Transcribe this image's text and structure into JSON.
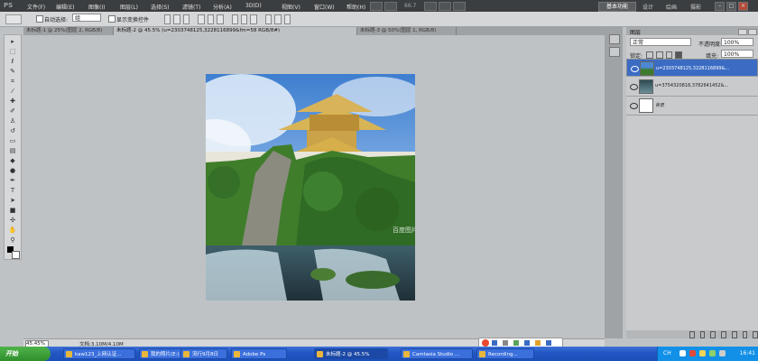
{
  "app": {
    "logo": "PS",
    "menu": [
      "文件(F)",
      "编辑(E)",
      "图像(I)",
      "图层(L)",
      "选择(S)",
      "滤镜(T)",
      "分析(A)",
      "3D(D)",
      "视图(V)",
      "窗口(W)",
      "帮助(H)"
    ],
    "zoom_readout": "66.7",
    "workspaces": {
      "active": "基本功能",
      "others": [
        "设计",
        "绘画",
        "摄影"
      ]
    }
  },
  "options": {
    "auto_select_label": "自动选择:",
    "auto_select_value": "组",
    "transform_label": "显示变换控件"
  },
  "tabs": [
    "未标题-1 @ 25%(图层 2, RGB/8)",
    "未标题-2 @ 45.5% (u=2303748125,3228116899&fm=58 RGB/8#)",
    "未标题-3 @ 50%(图层 1, RGB/8)"
  ],
  "layers_panel": {
    "title": "图层",
    "blend_mode": "正常",
    "opacity_label": "不透明度:",
    "opacity_value": "100%",
    "lock_label": "锁定:",
    "fill_label": "填充:",
    "fill_value": "100%",
    "layers": [
      {
        "name": "u=2303748125,3228116899&...",
        "selected": true
      },
      {
        "name": "u=3754320818,3782641452&...",
        "selected": false
      },
      {
        "name": "背景",
        "selected": false
      }
    ]
  },
  "document": {
    "watermark": "百度图片"
  },
  "status": {
    "zoom": "45.45%",
    "doc_info": "文档:3.10M/4.10M"
  },
  "taskbar": {
    "start_label": "开始",
    "buttons": [
      {
        "label": "kaw123_上网认证..."
      },
      {
        "label": "我的照片(E:)"
      },
      {
        "label": "流行9月8日"
      },
      {
        "label": "Adobe Ps"
      },
      {
        "label": "未标题-2 @ 45.5%"
      },
      {
        "label": "Camtasia Studio ..."
      },
      {
        "label": "Recording..."
      }
    ],
    "tray_lang": "CH",
    "clock": "16:41"
  }
}
